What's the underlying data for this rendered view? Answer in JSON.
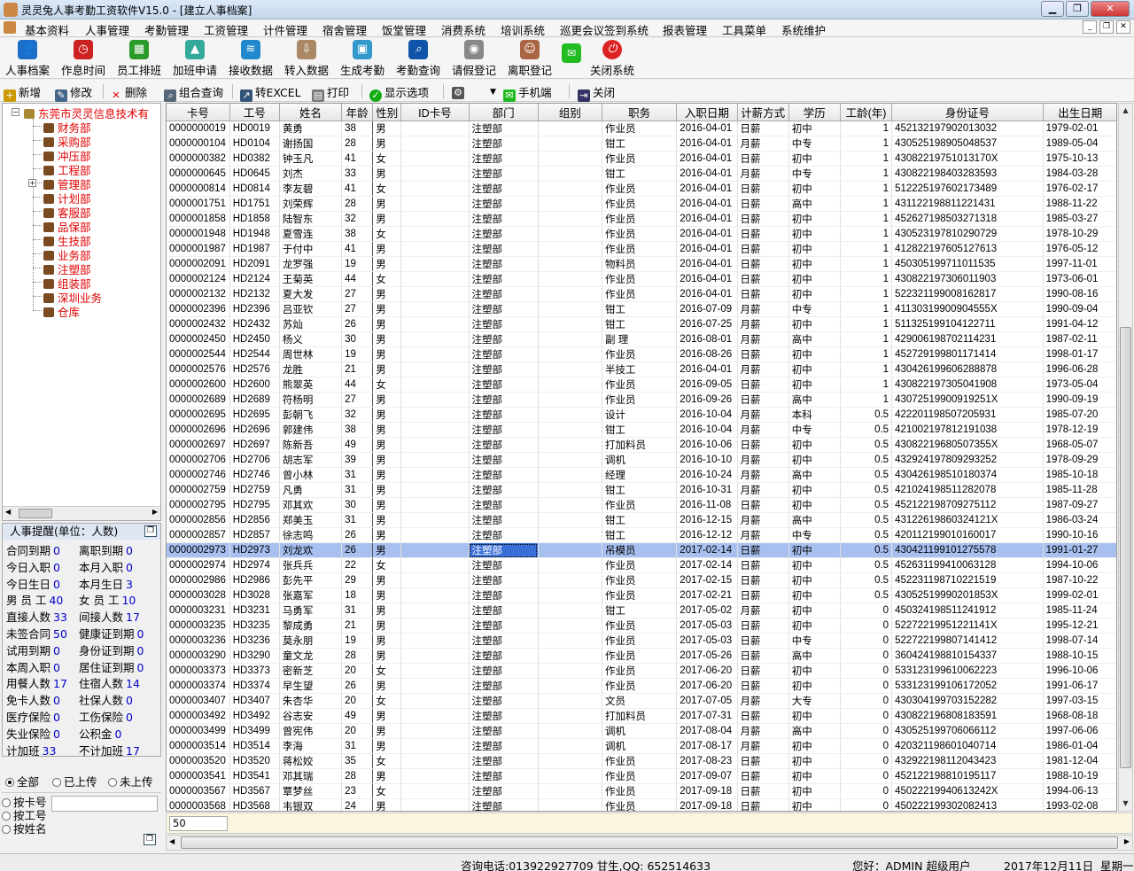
{
  "window": {
    "title": "灵灵兔人事考勤工资软件V15.0 - [建立人事档案]"
  },
  "menu": [
    "基本资料",
    "人事管理",
    "考勤管理",
    "工资管理",
    "计件管理",
    "宿舍管理",
    "饭堂管理",
    "消费系统",
    "培训系统",
    "巡更会议签到系统",
    "报表管理",
    "工具菜单",
    "系统维护"
  ],
  "toolbar": [
    "人事档案",
    "作息时间",
    "员工排班",
    "加班申请",
    "接收数据",
    "转入数据",
    "生成考勤",
    "考勤查询",
    "请假登记",
    "离职登记",
    "关闭系统"
  ],
  "toolbar2": {
    "add": "新增",
    "edit": "修改",
    "delete": "删除",
    "combo_query": "组合查询",
    "to_excel": "转EXCEL",
    "print": "打印",
    "display_options": "显示选项",
    "mobile": "手机端",
    "close": "关闭"
  },
  "tree": {
    "root": "东莞市灵灵信息技术有",
    "departments": [
      "财务部",
      "采购部",
      "冲压部",
      "工程部",
      "管理部",
      "计划部",
      "客服部",
      "品保部",
      "生技部",
      "业务部",
      "注塑部",
      "组装部",
      "深圳业务",
      "仓库"
    ]
  },
  "hr_panel": {
    "title": "人事提醒(单位：人数)",
    "stats": [
      {
        "label": "合同到期",
        "value": "0"
      },
      {
        "label": "离职到期",
        "value": "0"
      },
      {
        "label": "今日入职",
        "value": "0"
      },
      {
        "label": "本月入职",
        "value": "0"
      },
      {
        "label": "今日生日",
        "value": "0"
      },
      {
        "label": "本月生日",
        "value": "3"
      },
      {
        "label": "男 员 工",
        "value": "40"
      },
      {
        "label": "女 员 工",
        "value": "10"
      },
      {
        "label": "直接人数",
        "value": "33"
      },
      {
        "label": "间接人数",
        "value": "17"
      },
      {
        "label": "未签合同",
        "value": "50"
      },
      {
        "label": "健康证到期",
        "value": "0"
      },
      {
        "label": "试用到期",
        "value": "0"
      },
      {
        "label": "身份证到期",
        "value": "0"
      },
      {
        "label": "本周入职",
        "value": "0"
      },
      {
        "label": "居住证到期",
        "value": "0"
      },
      {
        "label": "用餐人数",
        "value": "17"
      },
      {
        "label": "住宿人数",
        "value": "14"
      },
      {
        "label": "免卡人数",
        "value": "0"
      },
      {
        "label": "社保人数",
        "value": "0"
      },
      {
        "label": "医疗保险",
        "value": "0"
      },
      {
        "label": "工伤保险",
        "value": "0"
      },
      {
        "label": "失业保险",
        "value": "0"
      },
      {
        "label": "公积金",
        "value": "0"
      },
      {
        "label": "计加班",
        "value": "33"
      },
      {
        "label": "不计加班",
        "value": "17"
      }
    ]
  },
  "filter": {
    "all": "全部",
    "uploaded": "已上传",
    "not_uploaded": "未上传",
    "by_card": "按卡号",
    "by_id": "按工号",
    "by_name": "按姓名"
  },
  "table": {
    "columns": [
      "卡号",
      "工号",
      "姓名",
      "年龄",
      "性别",
      "ID卡号",
      "部门",
      "组别",
      "职务",
      "入职日期",
      "计薪方式",
      "学历",
      "工龄(年)",
      "身份证号",
      "出生日期"
    ],
    "rows": [
      [
        "0000000019",
        "HD0019",
        "黄勇",
        "38",
        "男",
        "",
        "注塑部",
        "",
        "作业员",
        "2016-04-01",
        "日薪",
        "初中",
        "1",
        "452132197902013032",
        "1979-02-01"
      ],
      [
        "0000000104",
        "HD0104",
        "谢扬国",
        "28",
        "男",
        "",
        "注塑部",
        "",
        "钳工",
        "2016-04-01",
        "月薪",
        "中专",
        "1",
        "430525198905048537",
        "1989-05-04"
      ],
      [
        "0000000382",
        "HD0382",
        "钟玉凡",
        "41",
        "女",
        "",
        "注塑部",
        "",
        "作业员",
        "2016-04-01",
        "日薪",
        "初中",
        "1",
        "43082219751013170X",
        "1975-10-13"
      ],
      [
        "0000000645",
        "HD0645",
        "刘杰",
        "33",
        "男",
        "",
        "注塑部",
        "",
        "钳工",
        "2016-04-01",
        "月薪",
        "中专",
        "1",
        "430822198403283593",
        "1984-03-28"
      ],
      [
        "0000000814",
        "HD0814",
        "李友碧",
        "41",
        "女",
        "",
        "注塑部",
        "",
        "作业员",
        "2016-04-01",
        "日薪",
        "初中",
        "1",
        "512225197602173489",
        "1976-02-17"
      ],
      [
        "0000001751",
        "HD1751",
        "刘荣辉",
        "28",
        "男",
        "",
        "注塑部",
        "",
        "作业员",
        "2016-04-01",
        "日薪",
        "高中",
        "1",
        "431122198811221431",
        "1988-11-22"
      ],
      [
        "0000001858",
        "HD1858",
        "陆智东",
        "32",
        "男",
        "",
        "注塑部",
        "",
        "作业员",
        "2016-04-01",
        "日薪",
        "初中",
        "1",
        "452627198503271318",
        "1985-03-27"
      ],
      [
        "0000001948",
        "HD1948",
        "夏雪连",
        "38",
        "女",
        "",
        "注塑部",
        "",
        "作业员",
        "2016-04-01",
        "日薪",
        "初中",
        "1",
        "430523197810290729",
        "1978-10-29"
      ],
      [
        "0000001987",
        "HD1987",
        "于付中",
        "41",
        "男",
        "",
        "注塑部",
        "",
        "作业员",
        "2016-04-01",
        "日薪",
        "初中",
        "1",
        "412822197605127613",
        "1976-05-12"
      ],
      [
        "0000002091",
        "HD2091",
        "龙罗强",
        "19",
        "男",
        "",
        "注塑部",
        "",
        "物料员",
        "2016-04-01",
        "日薪",
        "初中",
        "1",
        "450305199711011535",
        "1997-11-01"
      ],
      [
        "0000002124",
        "HD2124",
        "王菊英",
        "44",
        "女",
        "",
        "注塑部",
        "",
        "作业员",
        "2016-04-01",
        "日薪",
        "初中",
        "1",
        "430822197306011903",
        "1973-06-01"
      ],
      [
        "0000002132",
        "HD2132",
        "夏大发",
        "27",
        "男",
        "",
        "注塑部",
        "",
        "作业员",
        "2016-04-01",
        "日薪",
        "初中",
        "1",
        "522321199008162817",
        "1990-08-16"
      ],
      [
        "0000002396",
        "HD2396",
        "吕亚钦",
        "27",
        "男",
        "",
        "注塑部",
        "",
        "钳工",
        "2016-07-09",
        "月薪",
        "中专",
        "1",
        "41130319900904555X",
        "1990-09-04"
      ],
      [
        "0000002432",
        "HD2432",
        "苏灿",
        "26",
        "男",
        "",
        "注塑部",
        "",
        "钳工",
        "2016-07-25",
        "月薪",
        "初中",
        "1",
        "511325199104122711",
        "1991-04-12"
      ],
      [
        "0000002450",
        "HD2450",
        "杨义",
        "30",
        "男",
        "",
        "注塑部",
        "",
        "副 理",
        "2016-08-01",
        "月薪",
        "高中",
        "1",
        "429006198702114231",
        "1987-02-11"
      ],
      [
        "0000002544",
        "HD2544",
        "周世林",
        "19",
        "男",
        "",
        "注塑部",
        "",
        "作业员",
        "2016-08-26",
        "日薪",
        "初中",
        "1",
        "452729199801171414",
        "1998-01-17"
      ],
      [
        "0000002576",
        "HD2576",
        "龙胜",
        "21",
        "男",
        "",
        "注塑部",
        "",
        "半技工",
        "2016-04-01",
        "月薪",
        "初中",
        "1",
        "430426199606288878",
        "1996-06-28"
      ],
      [
        "0000002600",
        "HD2600",
        "熊翠英",
        "44",
        "女",
        "",
        "注塑部",
        "",
        "作业员",
        "2016-09-05",
        "日薪",
        "初中",
        "1",
        "430822197305041908",
        "1973-05-04"
      ],
      [
        "0000002689",
        "HD2689",
        "符杨明",
        "27",
        "男",
        "",
        "注塑部",
        "",
        "作业员",
        "2016-09-26",
        "日薪",
        "高中",
        "1",
        "43072519900919251X",
        "1990-09-19"
      ],
      [
        "0000002695",
        "HD2695",
        "彭朝飞",
        "32",
        "男",
        "",
        "注塑部",
        "",
        "设计",
        "2016-10-04",
        "月薪",
        "本科",
        "0.5",
        "422201198507205931",
        "1985-07-20"
      ],
      [
        "0000002696",
        "HD2696",
        "郭建伟",
        "38",
        "男",
        "",
        "注塑部",
        "",
        "钳工",
        "2016-10-04",
        "月薪",
        "中专",
        "0.5",
        "421002197812191038",
        "1978-12-19"
      ],
      [
        "0000002697",
        "HD2697",
        "陈新吾",
        "49",
        "男",
        "",
        "注塑部",
        "",
        "打加料员",
        "2016-10-06",
        "日薪",
        "初中",
        "0.5",
        "43082219680507355X",
        "1968-05-07"
      ],
      [
        "0000002706",
        "HD2706",
        "胡志军",
        "39",
        "男",
        "",
        "注塑部",
        "",
        "调机",
        "2016-10-10",
        "月薪",
        "初中",
        "0.5",
        "432924197809293252",
        "1978-09-29"
      ],
      [
        "0000002746",
        "HD2746",
        "曾小林",
        "31",
        "男",
        "",
        "注塑部",
        "",
        "经理",
        "2016-10-24",
        "月薪",
        "高中",
        "0.5",
        "430426198510180374",
        "1985-10-18"
      ],
      [
        "0000002759",
        "HD2759",
        "凡勇",
        "31",
        "男",
        "",
        "注塑部",
        "",
        "钳工",
        "2016-10-31",
        "月薪",
        "初中",
        "0.5",
        "421024198511282078",
        "1985-11-28"
      ],
      [
        "0000002795",
        "HD2795",
        "邓其欢",
        "30",
        "男",
        "",
        "注塑部",
        "",
        "作业员",
        "2016-11-08",
        "日薪",
        "初中",
        "0.5",
        "452122198709275112",
        "1987-09-27"
      ],
      [
        "0000002856",
        "HD2856",
        "郑美玉",
        "31",
        "男",
        "",
        "注塑部",
        "",
        "钳工",
        "2016-12-15",
        "月薪",
        "高中",
        "0.5",
        "43122619860324121X",
        "1986-03-24"
      ],
      [
        "0000002857",
        "HD2857",
        "徐志鸣",
        "26",
        "男",
        "",
        "注塑部",
        "",
        "钳工",
        "2016-12-12",
        "月薪",
        "中专",
        "0.5",
        "420112199010160017",
        "1990-10-16"
      ],
      [
        "0000002973",
        "HD2973",
        "刘龙欢",
        "26",
        "男",
        "",
        "注塑部",
        "",
        "吊模员",
        "2017-02-14",
        "日薪",
        "初中",
        "0.5",
        "430421199101275578",
        "1991-01-27"
      ],
      [
        "0000002974",
        "HD2974",
        "张兵兵",
        "22",
        "女",
        "",
        "注塑部",
        "",
        "作业员",
        "2017-02-14",
        "日薪",
        "初中",
        "0.5",
        "452631199410063128",
        "1994-10-06"
      ],
      [
        "0000002986",
        "HD2986",
        "彭先平",
        "29",
        "男",
        "",
        "注塑部",
        "",
        "作业员",
        "2017-02-15",
        "日薪",
        "初中",
        "0.5",
        "452231198710221519",
        "1987-10-22"
      ],
      [
        "0000003028",
        "HD3028",
        "张嘉军",
        "18",
        "男",
        "",
        "注塑部",
        "",
        "作业员",
        "2017-02-21",
        "日薪",
        "初中",
        "0.5",
        "43052519990201853X",
        "1999-02-01"
      ],
      [
        "0000003231",
        "HD3231",
        "马勇军",
        "31",
        "男",
        "",
        "注塑部",
        "",
        "钳工",
        "2017-05-02",
        "月薪",
        "初中",
        "0",
        "450324198511241912",
        "1985-11-24"
      ],
      [
        "0000003235",
        "HD3235",
        "黎成勇",
        "21",
        "男",
        "",
        "注塑部",
        "",
        "作业员",
        "2017-05-03",
        "日薪",
        "初中",
        "0",
        "52272219951221141X",
        "1995-12-21"
      ],
      [
        "0000003236",
        "HD3236",
        "莫永朋",
        "19",
        "男",
        "",
        "注塑部",
        "",
        "作业员",
        "2017-05-03",
        "日薪",
        "中专",
        "0",
        "522722199807141412",
        "1998-07-14"
      ],
      [
        "0000003290",
        "HD3290",
        "童文龙",
        "28",
        "男",
        "",
        "注塑部",
        "",
        "作业员",
        "2017-05-26",
        "日薪",
        "高中",
        "0",
        "360424198810154337",
        "1988-10-15"
      ],
      [
        "0000003373",
        "HD3373",
        "密新芝",
        "20",
        "女",
        "",
        "注塑部",
        "",
        "作业员",
        "2017-06-20",
        "日薪",
        "初中",
        "0",
        "533123199610062223",
        "1996-10-06"
      ],
      [
        "0000003374",
        "HD3374",
        "早生望",
        "26",
        "男",
        "",
        "注塑部",
        "",
        "作业员",
        "2017-06-20",
        "日薪",
        "初中",
        "0",
        "533123199106172052",
        "1991-06-17"
      ],
      [
        "0000003407",
        "HD3407",
        "朱杏华",
        "20",
        "女",
        "",
        "注塑部",
        "",
        "文员",
        "2017-07-05",
        "月薪",
        "大专",
        "0",
        "430304199703152282",
        "1997-03-15"
      ],
      [
        "0000003492",
        "HD3492",
        "谷志安",
        "49",
        "男",
        "",
        "注塑部",
        "",
        "打加料员",
        "2017-07-31",
        "日薪",
        "初中",
        "0",
        "430822196808183591",
        "1968-08-18"
      ],
      [
        "0000003499",
        "HD3499",
        "曾宪伟",
        "20",
        "男",
        "",
        "注塑部",
        "",
        "调机",
        "2017-08-04",
        "月薪",
        "高中",
        "0",
        "430525199706066112",
        "1997-06-06"
      ],
      [
        "0000003514",
        "HD3514",
        "李海",
        "31",
        "男",
        "",
        "注塑部",
        "",
        "调机",
        "2017-08-17",
        "月薪",
        "初中",
        "0",
        "420321198601040714",
        "1986-01-04"
      ],
      [
        "0000003520",
        "HD3520",
        "蒋松姣",
        "35",
        "女",
        "",
        "注塑部",
        "",
        "作业员",
        "2017-08-23",
        "日薪",
        "初中",
        "0",
        "432922198112043423",
        "1981-12-04"
      ],
      [
        "0000003541",
        "HD3541",
        "邓其瑞",
        "28",
        "男",
        "",
        "注塑部",
        "",
        "作业员",
        "2017-09-07",
        "日薪",
        "初中",
        "0",
        "452122198810195117",
        "1988-10-19"
      ],
      [
        "0000003567",
        "HD3567",
        "覃梦丝",
        "23",
        "女",
        "",
        "注塑部",
        "",
        "作业员",
        "2017-09-18",
        "日薪",
        "初中",
        "0",
        "45022219940613242X",
        "1994-06-13"
      ],
      [
        "0000003568",
        "HD3568",
        "韦银双",
        "24",
        "男",
        "",
        "注塑部",
        "",
        "作业员",
        "2017-09-18",
        "日薪",
        "初中",
        "0",
        "450222199302082413",
        "1993-02-08"
      ]
    ],
    "selected_row": 28
  },
  "footer": {
    "count": "50"
  },
  "statusbar": {
    "contact": "咨询电话:013922927709 甘生,QQ: 652514633",
    "user": "您好：ADMIN 超级用户",
    "date": "2017年12月11日",
    "weekday": "星期一"
  },
  "colors": {
    "dept_text": "#e00000",
    "stat_value": "#0000c8",
    "selected_row": "#a8c0f0",
    "selected_cell": "#3a6fd8"
  }
}
